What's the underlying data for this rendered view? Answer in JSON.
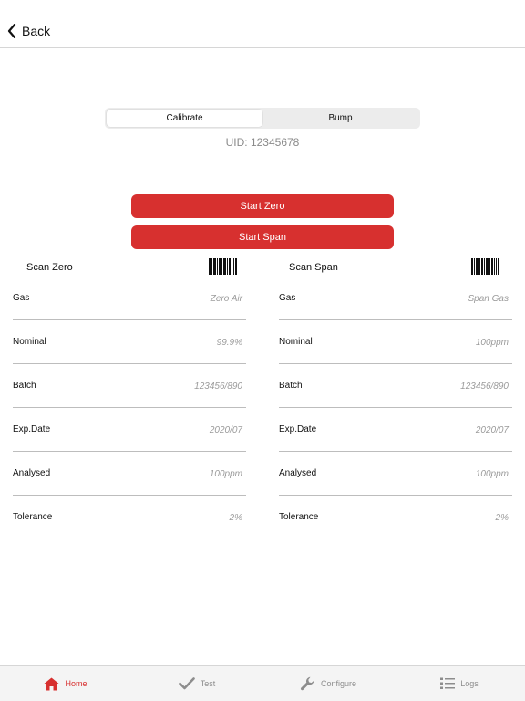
{
  "nav": {
    "back_label": "Back"
  },
  "segmented": {
    "options": [
      "Calibrate",
      "Bump"
    ],
    "selected": "Calibrate"
  },
  "uid_text": "UID: 12345678",
  "buttons": {
    "start_zero": "Start Zero",
    "start_span": "Start Span"
  },
  "zero": {
    "title": "Scan Zero",
    "fields": [
      {
        "label": "Gas",
        "value": "Zero Air"
      },
      {
        "label": "Nominal",
        "value": "99.9%"
      },
      {
        "label": "Batch",
        "value": "123456/890"
      },
      {
        "label": "Exp.Date",
        "value": "2020/07"
      },
      {
        "label": "Analysed",
        "value": "100ppm"
      },
      {
        "label": "Tolerance",
        "value": "2%"
      }
    ]
  },
  "span": {
    "title": "Scan Span",
    "fields": [
      {
        "label": "Gas",
        "value": "Span Gas"
      },
      {
        "label": "Nominal",
        "value": "100ppm"
      },
      {
        "label": "Batch",
        "value": "123456/890"
      },
      {
        "label": "Exp.Date",
        "value": "2020/07"
      },
      {
        "label": "Analysed",
        "value": "100ppm"
      },
      {
        "label": "Tolerance",
        "value": "2%"
      }
    ]
  },
  "tabs": [
    {
      "label": "Home",
      "icon": "home-icon",
      "active": true
    },
    {
      "label": "Test",
      "icon": "checkmark-icon",
      "active": false
    },
    {
      "label": "Configure",
      "icon": "wrench-icon",
      "active": false
    },
    {
      "label": "Logs",
      "icon": "list-icon",
      "active": false
    }
  ],
  "colors": {
    "accent": "#d7302f",
    "battery": "#34c759",
    "inactive": "#8d8d8d"
  }
}
